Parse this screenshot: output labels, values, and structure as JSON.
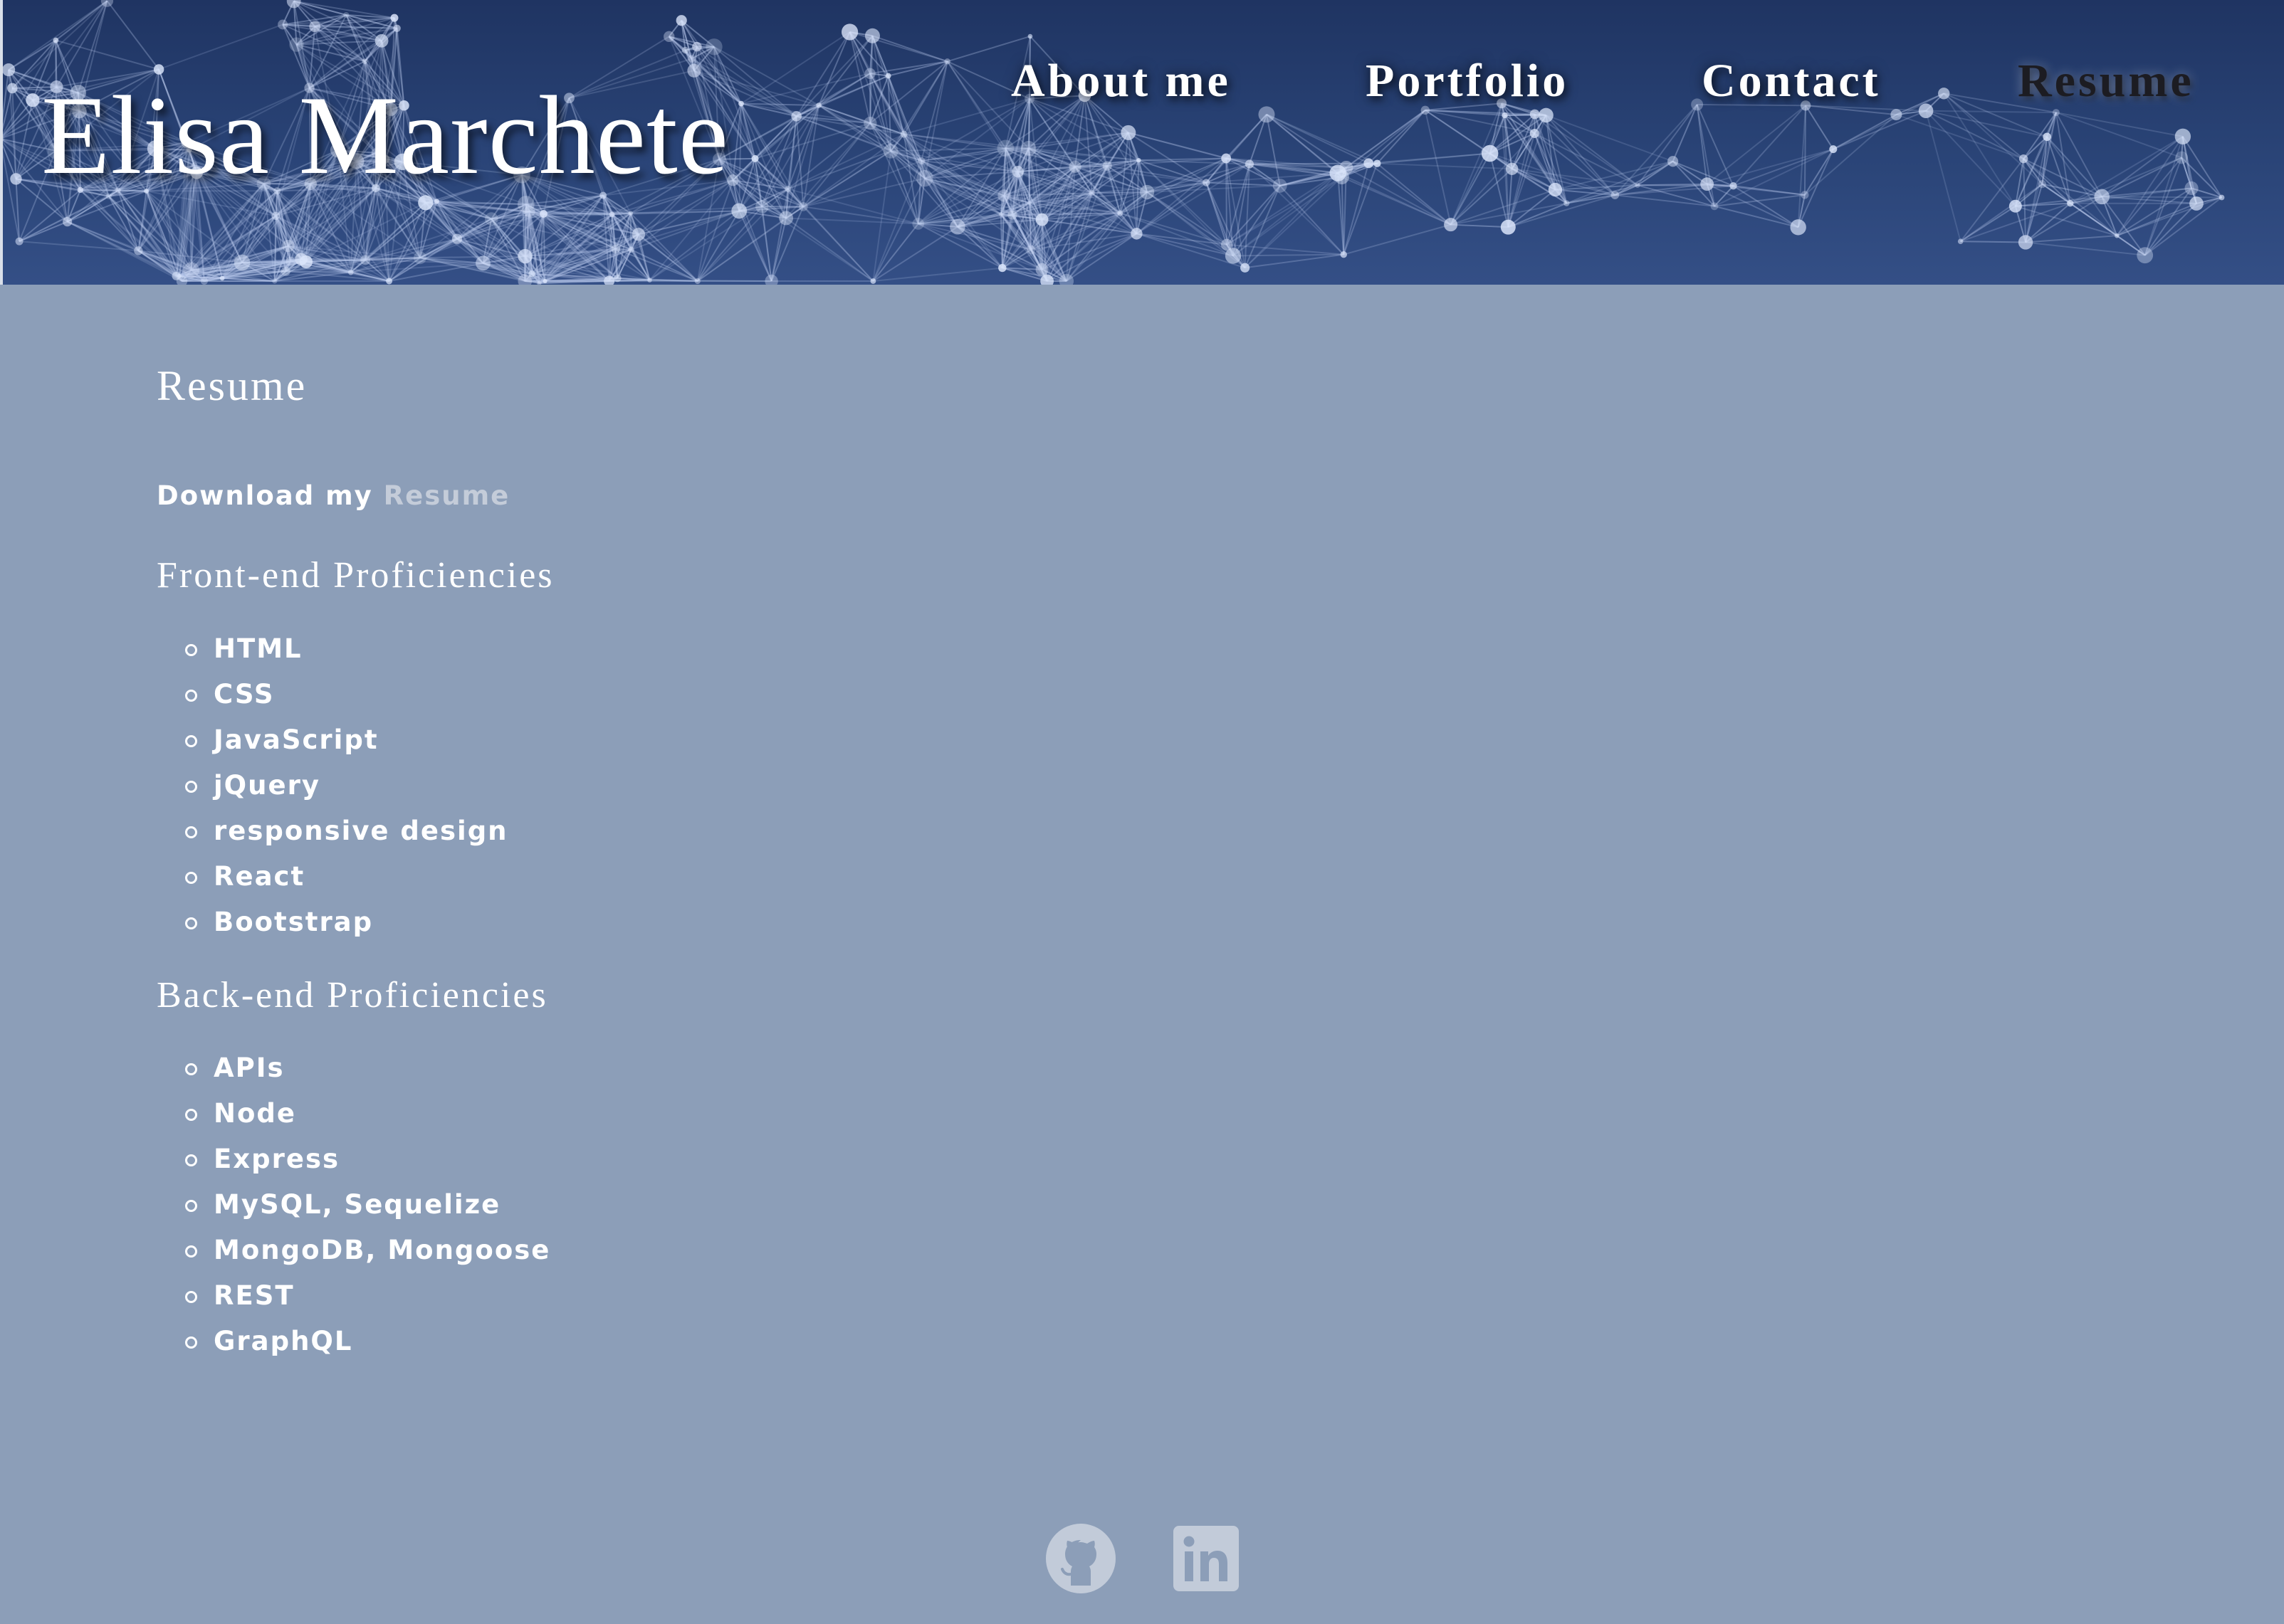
{
  "header": {
    "site_title": "Elisa Marchete",
    "nav": [
      {
        "label": "About me",
        "active": false
      },
      {
        "label": "Portfolio",
        "active": false
      },
      {
        "label": "Contact",
        "active": false
      },
      {
        "label": "Resume",
        "active": true
      }
    ]
  },
  "main": {
    "title": "Resume",
    "download": {
      "prefix": "Download my",
      "link_label": "Resume"
    },
    "frontend": {
      "title": "Front-end Proficiencies",
      "items": [
        "HTML",
        "CSS",
        "JavaScript",
        "jQuery",
        "responsive design",
        "React",
        "Bootstrap"
      ]
    },
    "backend": {
      "title": "Back-end Proficiencies",
      "items": [
        "APIs",
        "Node",
        "Express",
        "MySQL, Sequelize",
        "MongoDB, Mongoose",
        "REST",
        "GraphQL"
      ]
    }
  },
  "footer": {
    "icons": [
      "github-icon",
      "linkedin-icon"
    ],
    "icon_color": "#c2cbd9"
  },
  "colors": {
    "page_background": "#8c9eb8",
    "header_background": "#243a6b",
    "text": "#ffffff",
    "link": "#c4ccd9",
    "active_nav": "#1c1c22"
  }
}
